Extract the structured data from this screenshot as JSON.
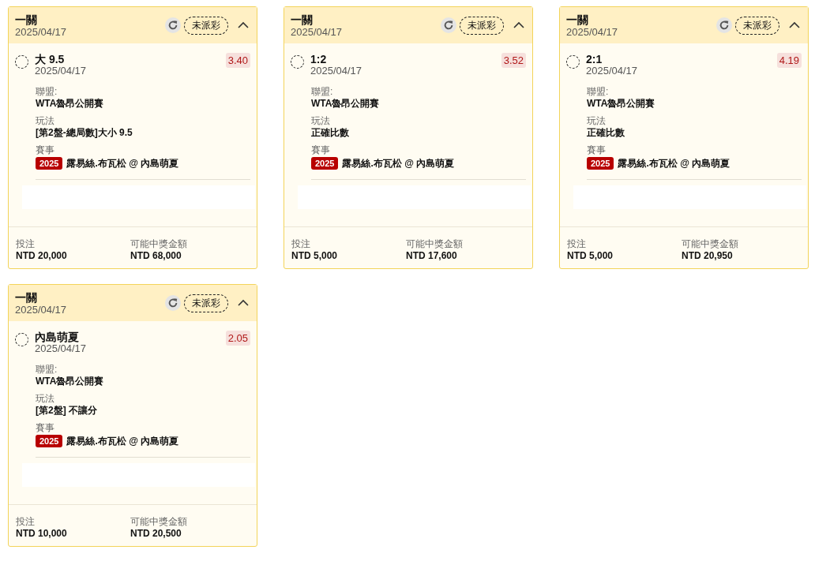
{
  "cards": [
    {
      "title": "一關",
      "date": "2025/04/17",
      "status": "未派彩",
      "expanded": true,
      "selected": false,
      "pick": "大 9.5",
      "pick_date": "2025/04/17",
      "odds": "3.40",
      "league_label": "聯盟:",
      "league": "WTA魯昂公開賽",
      "play_label": "玩法",
      "play": "[第2盤-總局數]大小 9.5",
      "event_label": "賽事",
      "event_badge": "2025",
      "event": "露易絲.布瓦松 @ 內島萌夏",
      "stake_label": "投注",
      "stake": "NTD 20,000",
      "payout_label": "可能中獎金額",
      "payout": "NTD 68,000"
    },
    {
      "title": "一關",
      "date": "2025/04/17",
      "status": "未派彩",
      "expanded": true,
      "selected": false,
      "pick": "1:2",
      "pick_date": "2025/04/17",
      "odds": "3.52",
      "league_label": "聯盟:",
      "league": "WTA魯昂公開賽",
      "play_label": "玩法",
      "play": "正確比數",
      "event_label": "賽事",
      "event_badge": "2025",
      "event": "露易絲.布瓦松 @ 內島萌夏",
      "stake_label": "投注",
      "stake": "NTD 5,000",
      "payout_label": "可能中獎金額",
      "payout": "NTD 17,600"
    },
    {
      "title": "一關",
      "date": "2025/04/17",
      "status": "未派彩",
      "expanded": true,
      "selected": false,
      "pick": "2:1",
      "pick_date": "2025/04/17",
      "odds": "4.19",
      "league_label": "聯盟:",
      "league": "WTA魯昂公開賽",
      "play_label": "玩法",
      "play": "正確比數",
      "event_label": "賽事",
      "event_badge": "2025",
      "event": "露易絲.布瓦松 @ 內島萌夏",
      "stake_label": "投注",
      "stake": "NTD 5,000",
      "payout_label": "可能中獎金額",
      "payout": "NTD 20,950"
    },
    {
      "title": "一關",
      "date": "2025/04/17",
      "status": "未派彩",
      "expanded": true,
      "selected": false,
      "pick": "內島萌夏",
      "pick_date": "2025/04/17",
      "odds": "2.05",
      "league_label": "聯盟:",
      "league": "WTA魯昂公開賽",
      "play_label": "玩法",
      "play": "[第2盤] 不讓分",
      "event_label": "賽事",
      "event_badge": "2025",
      "event": "露易絲.布瓦松 @ 內島萌夏",
      "stake_label": "投注",
      "stake": "NTD 10,000",
      "payout_label": "可能中獎金額",
      "payout": "NTD 20,500"
    }
  ]
}
